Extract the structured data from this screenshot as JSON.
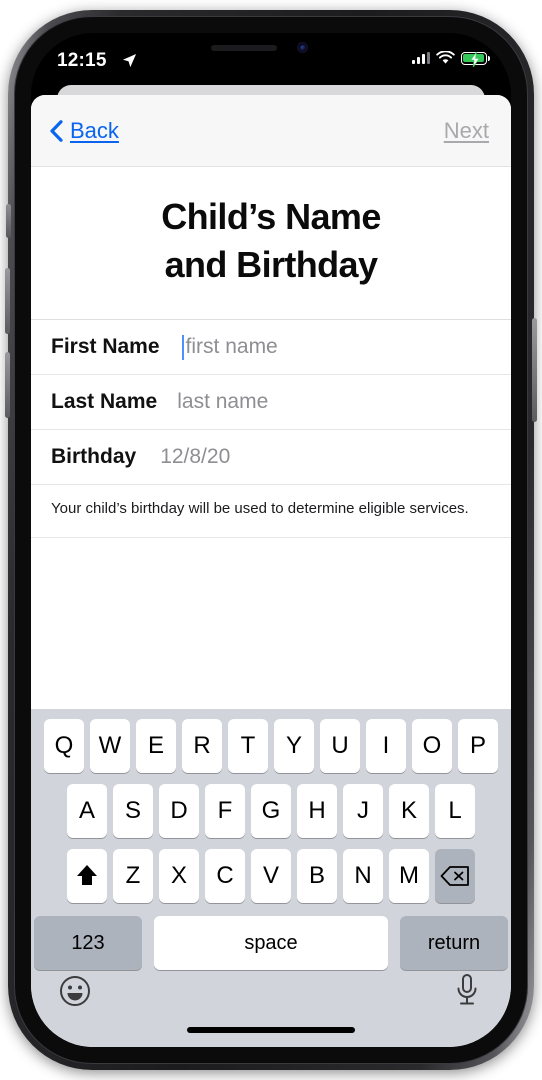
{
  "status_bar": {
    "time": "12:15",
    "location_icon": "location-arrow-icon",
    "signal_icon": "cellular-signal-icon",
    "wifi_icon": "wifi-icon",
    "battery_icon": "battery-charging-icon",
    "battery_color": "#34c759"
  },
  "nav": {
    "back_label": "Back",
    "back_icon": "chevron-left-icon",
    "back_color": "#0a64f0",
    "next_label": "Next",
    "next_color": "#a9a9ad"
  },
  "page": {
    "title_line1": "Child’s Name",
    "title_line2": "and Birthday"
  },
  "form": {
    "rows": [
      {
        "label": "First Name",
        "value": "",
        "placeholder": "first name",
        "focused": true
      },
      {
        "label": "Last Name",
        "value": "",
        "placeholder": "last name",
        "focused": false
      },
      {
        "label": "Birthday",
        "value": "12/8/20",
        "placeholder": "",
        "focused": false
      }
    ],
    "helper_text": "Your child’s birthday will be used to determine eligible services."
  },
  "keyboard": {
    "row1": [
      "Q",
      "W",
      "E",
      "R",
      "T",
      "Y",
      "U",
      "I",
      "O",
      "P"
    ],
    "row2": [
      "A",
      "S",
      "D",
      "F",
      "G",
      "H",
      "J",
      "K",
      "L"
    ],
    "row3": [
      "Z",
      "X",
      "C",
      "V",
      "B",
      "N",
      "M"
    ],
    "shift_icon": "shift-arrow-icon",
    "delete_icon": "backspace-delete-icon",
    "numbers_label": "123",
    "space_label": "space",
    "return_label": "return",
    "emoji_icon": "emoji-smiley-icon",
    "mic_icon": "microphone-icon",
    "background_color": "#d1d5db"
  }
}
